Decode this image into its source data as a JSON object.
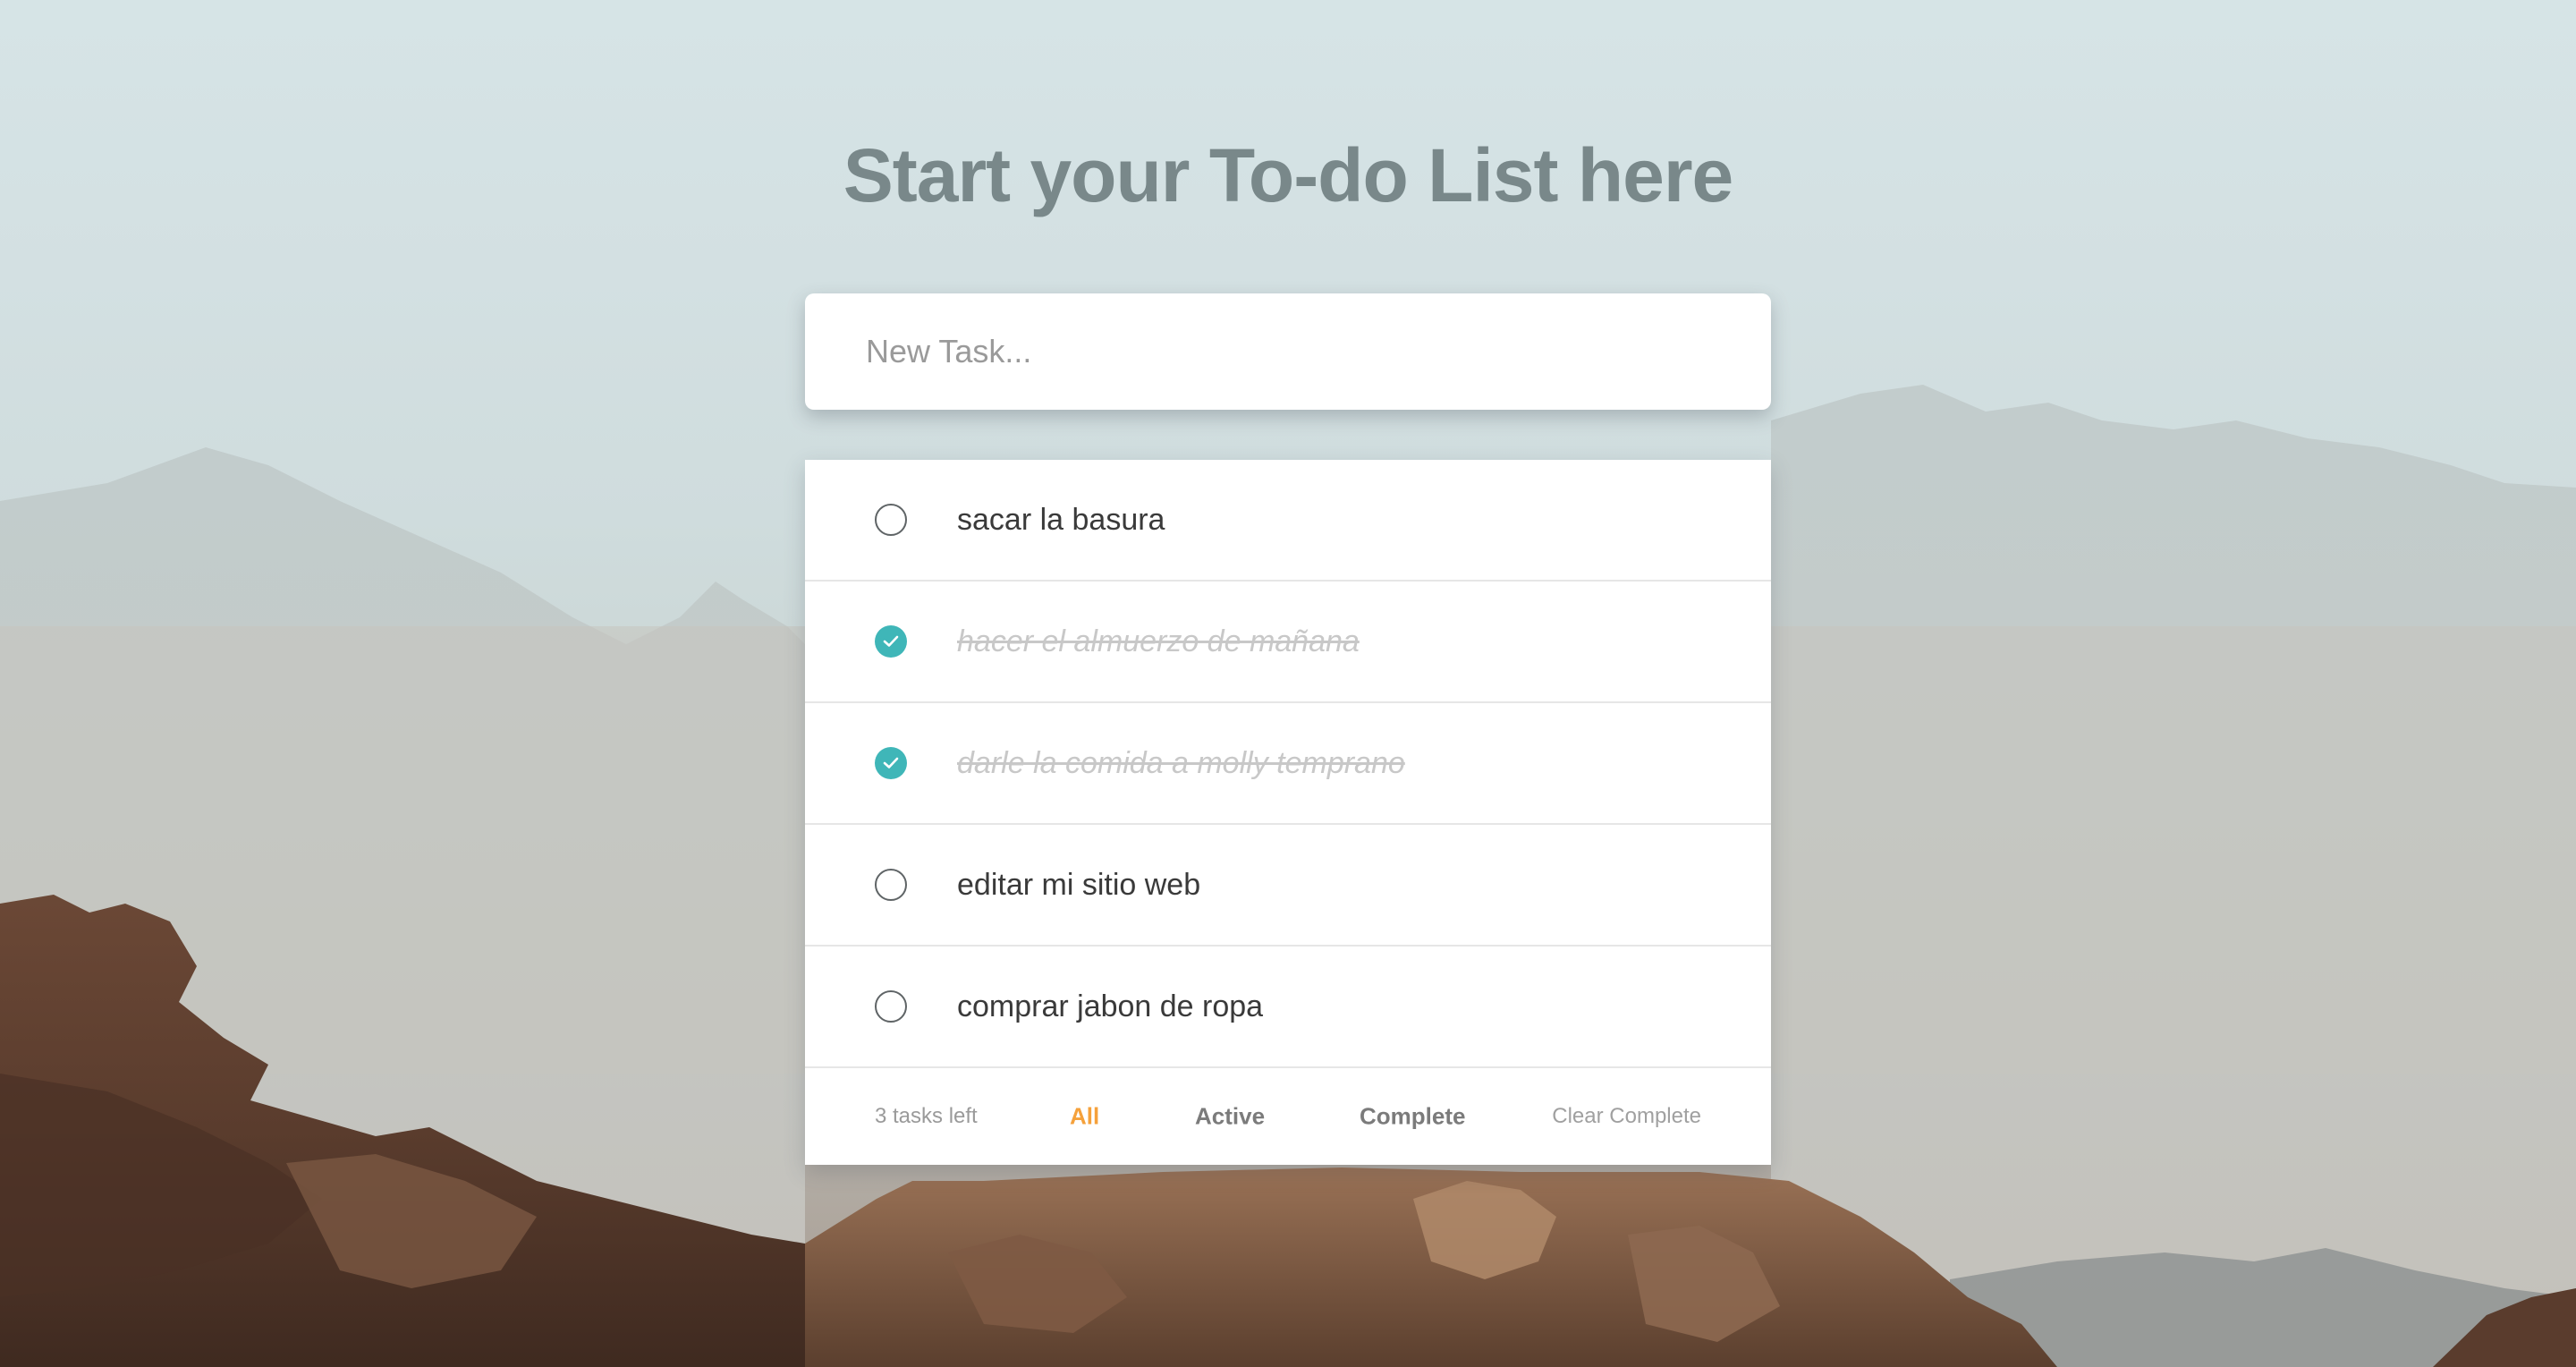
{
  "header": {
    "title": "Start your To-do List here"
  },
  "new_task": {
    "placeholder": "New Task...",
    "value": ""
  },
  "todos": [
    {
      "text": "sacar la basura",
      "completed": false
    },
    {
      "text": "hacer el almuerzo de mañana",
      "completed": true
    },
    {
      "text": "darle la comida a molly temprano",
      "completed": true
    },
    {
      "text": "editar mi sitio web",
      "completed": false
    },
    {
      "text": "comprar jabon de ropa",
      "completed": false
    }
  ],
  "footer": {
    "count_label": "3 tasks left",
    "filters": {
      "all": "All",
      "active": "Active",
      "complete": "Complete"
    },
    "selected_filter": "All",
    "clear_label": "Clear Complete"
  },
  "colors": {
    "title": "#79888a",
    "check_accent": "#3fb6b8",
    "filter_active": "#f5a13b"
  }
}
